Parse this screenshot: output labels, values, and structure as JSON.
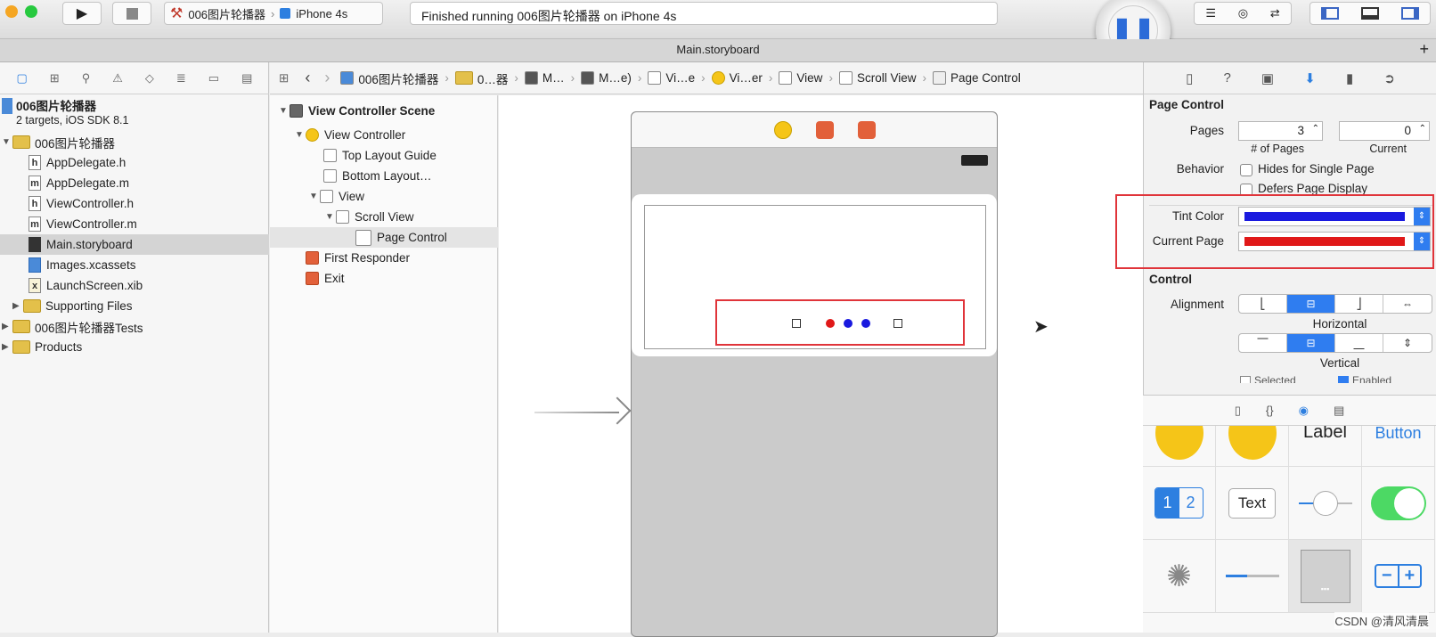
{
  "toolbar": {
    "scheme_target": "006图片轮播器",
    "scheme_device": "iPhone 4s",
    "status_text": "Finished running 006图片轮播器 on iPhone 4s"
  },
  "tab": {
    "title": "Main.storyboard",
    "add": "+"
  },
  "navigator": {
    "project_name": "006图片轮播器",
    "project_subtitle": "2 targets, iOS SDK 8.1",
    "items": [
      {
        "label": "006图片轮播器",
        "kind": "folder"
      },
      {
        "label": "AppDelegate.h",
        "kind": "h"
      },
      {
        "label": "AppDelegate.m",
        "kind": "m"
      },
      {
        "label": "ViewController.h",
        "kind": "h"
      },
      {
        "label": "ViewController.m",
        "kind": "m"
      },
      {
        "label": "Main.storyboard",
        "kind": "storyboard"
      },
      {
        "label": "Images.xcassets",
        "kind": "assets"
      },
      {
        "label": "LaunchScreen.xib",
        "kind": "xib"
      },
      {
        "label": "Supporting Files",
        "kind": "folder"
      },
      {
        "label": "006图片轮播器Tests",
        "kind": "folder"
      },
      {
        "label": "Products",
        "kind": "folder"
      }
    ]
  },
  "jumpbar": {
    "crumbs": [
      "006图片轮播器",
      "0…器",
      "M…",
      "M…e)",
      "Vi…e",
      "Vi…er",
      "View",
      "Scroll View",
      "Page Control"
    ]
  },
  "outline": {
    "scene": "View Controller Scene",
    "view_controller": "View Controller",
    "top_layout": "Top Layout Guide",
    "bottom_layout": "Bottom Layout…",
    "view": "View",
    "scroll_view": "Scroll View",
    "page_control": "Page Control",
    "first_responder": "First Responder",
    "exit": "Exit"
  },
  "inspector": {
    "section_page_control": "Page Control",
    "pages_label": "Pages",
    "pages_value": "3",
    "pages_caption": "# of Pages",
    "current_value": "0",
    "current_caption": "Current",
    "behavior_label": "Behavior",
    "hides_single": "Hides for Single Page",
    "defers_display": "Defers Page Display",
    "tint_label": "Tint Color",
    "tint_color": "#1a1adf",
    "current_page_label": "Current Page",
    "current_page_color": "#e01818",
    "section_control": "Control",
    "alignment_label": "Alignment",
    "horizontal_caption": "Horizontal",
    "vertical_caption": "Vertical",
    "content_selected": "Selected",
    "content_enabled": "Enabled"
  },
  "library": {
    "label_text": "Label",
    "button_text": "Button",
    "seg_1": "1",
    "seg_2": "2",
    "text_field": "Text",
    "minus": "−",
    "plus": "+"
  },
  "watermark": "CSDN @清风清晨"
}
